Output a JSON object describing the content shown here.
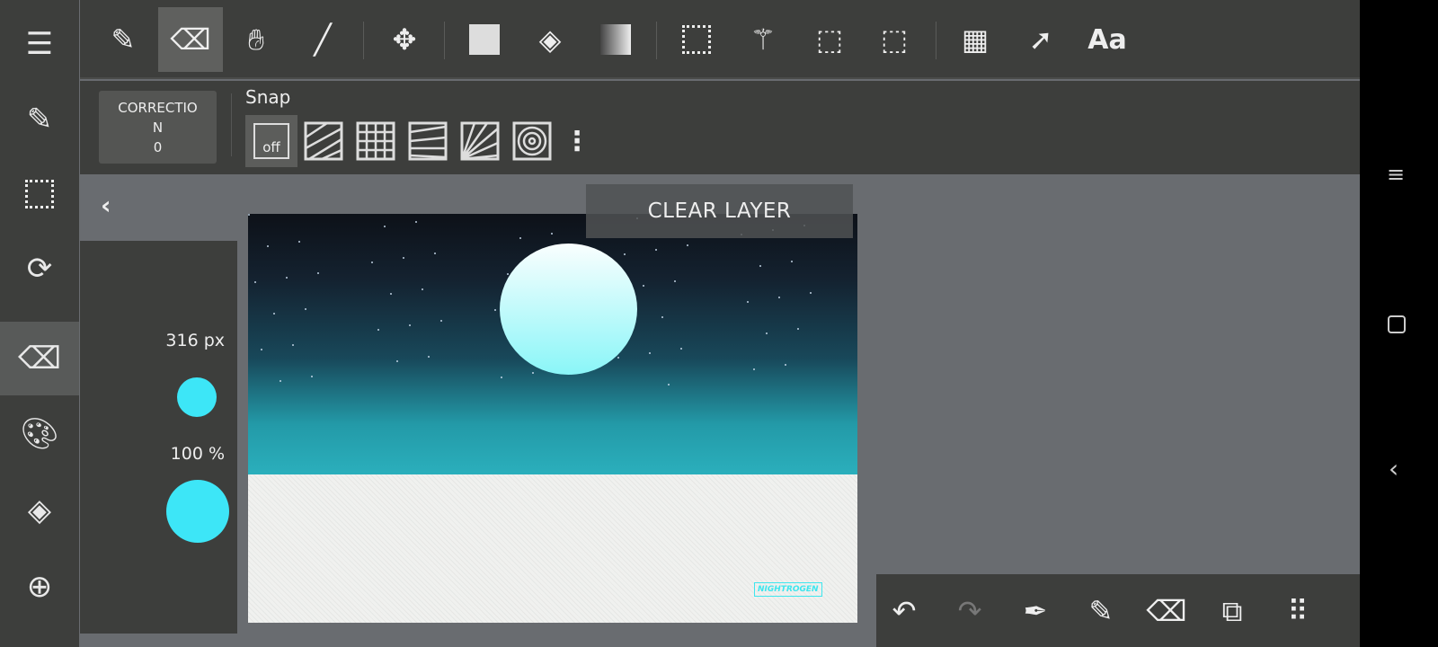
{
  "sidebar": {
    "items": [
      "menu",
      "edit",
      "selection",
      "rotate",
      "eraser",
      "color",
      "layers",
      "materials"
    ],
    "active": "eraser"
  },
  "toolbar": {
    "tools": [
      "pen",
      "eraser",
      "hand",
      "line",
      "move",
      "fill-rect",
      "bucket",
      "gradient",
      "select-rect",
      "magic-wand",
      "select-pen",
      "select-eraser",
      "panel",
      "operation",
      "text"
    ],
    "active": "eraser",
    "text_label": "Aa"
  },
  "subbar": {
    "correction_label": "CORRECTIO\nN",
    "correction_value": "0",
    "snap_label": "Snap",
    "snap_off": "off"
  },
  "canvas": {
    "clear_layer": "CLEAR LAYER",
    "signature": "NIGHTROGEN"
  },
  "brush_panel": {
    "size": "316 px",
    "opacity": "100 %",
    "color": "#3de6f7"
  },
  "bottom": [
    "undo",
    "redo",
    "eyedropper",
    "pen",
    "eraser",
    "export",
    "grid"
  ],
  "colors": {
    "accent": "#3de6f7",
    "bar": "#3d3e3c",
    "workspace": "#696c70"
  }
}
